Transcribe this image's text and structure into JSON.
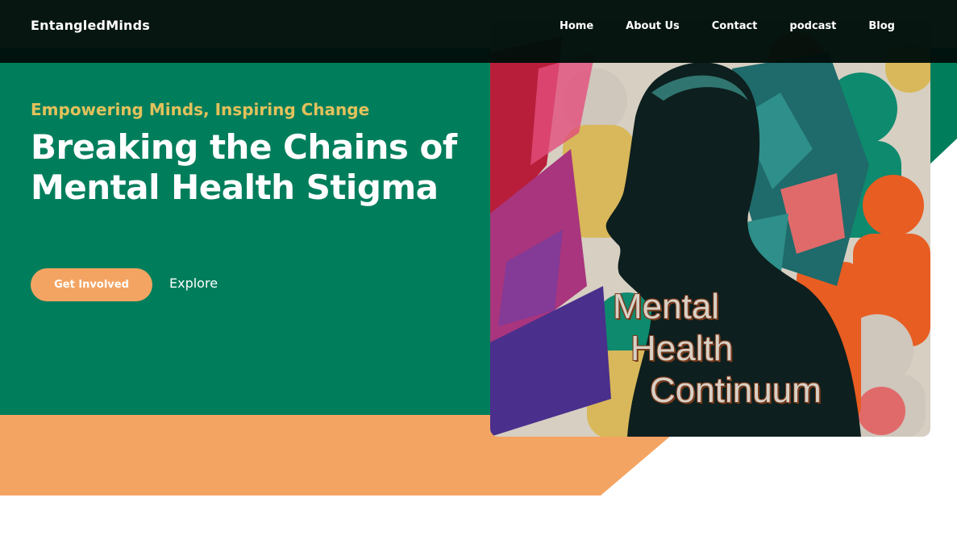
{
  "brand": {
    "name": "EntangledMinds"
  },
  "nav": {
    "items": [
      {
        "label": "Home"
      },
      {
        "label": "About Us"
      },
      {
        "label": "Contact"
      },
      {
        "label": "podcast"
      },
      {
        "label": "Blog"
      }
    ]
  },
  "hero": {
    "tagline": "Empowering Minds, Inspiring Change",
    "title": "Breaking the Chains of Mental Health Stigma",
    "primary_button": "Get Involved",
    "secondary_link": "Explore",
    "image": {
      "caption_lines": [
        "Mental",
        "Health",
        "Continuum"
      ]
    }
  },
  "colors": {
    "green": "#007e5c",
    "orange": "#f4a462",
    "tagline": "#e3c15b",
    "header": "#000e0a"
  }
}
